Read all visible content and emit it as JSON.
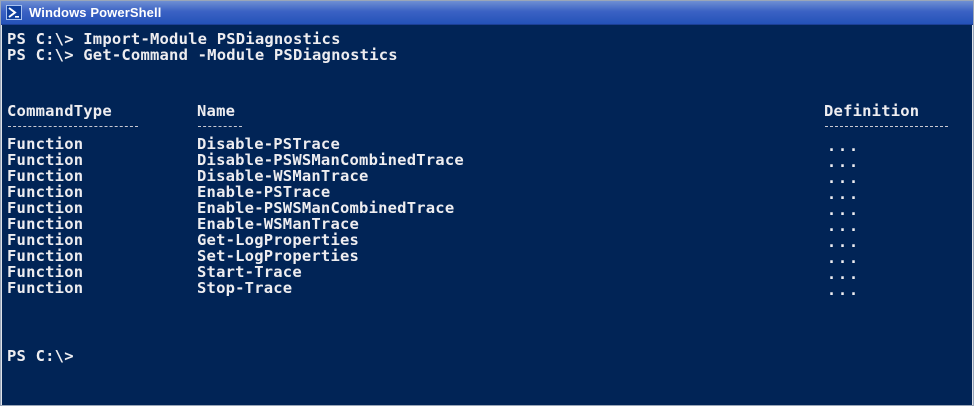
{
  "window": {
    "title": "Windows PowerShell"
  },
  "console": {
    "lines": [
      "PS C:\\> Import-Module PSDiagnostics",
      "PS C:\\> Get-Command -Module PSDiagnostics"
    ],
    "headers": {
      "command_type": "CommandType",
      "name": "Name",
      "definition": "Definition"
    },
    "separators": {
      "command_type": "-----------",
      "name": "----",
      "definition": "----------"
    },
    "rows": [
      {
        "command_type": "Function",
        "name": "Disable-PSTrace",
        "definition": "..."
      },
      {
        "command_type": "Function",
        "name": "Disable-PSWSManCombinedTrace",
        "definition": "..."
      },
      {
        "command_type": "Function",
        "name": "Disable-WSManTrace",
        "definition": "..."
      },
      {
        "command_type": "Function",
        "name": "Enable-PSTrace",
        "definition": "..."
      },
      {
        "command_type": "Function",
        "name": "Enable-PSWSManCombinedTrace",
        "definition": "..."
      },
      {
        "command_type": "Function",
        "name": "Enable-WSManTrace",
        "definition": "..."
      },
      {
        "command_type": "Function",
        "name": "Get-LogProperties",
        "definition": "..."
      },
      {
        "command_type": "Function",
        "name": "Set-LogProperties",
        "definition": "..."
      },
      {
        "command_type": "Function",
        "name": "Start-Trace",
        "definition": "..."
      },
      {
        "command_type": "Function",
        "name": "Stop-Trace",
        "definition": "..."
      }
    ],
    "prompt": "PS C:\\>"
  },
  "colors": {
    "console_background": "#012456",
    "console_text": "#eeedf0",
    "titlebar": "#2452b8"
  },
  "icons": {
    "app": "powershell-icon"
  }
}
